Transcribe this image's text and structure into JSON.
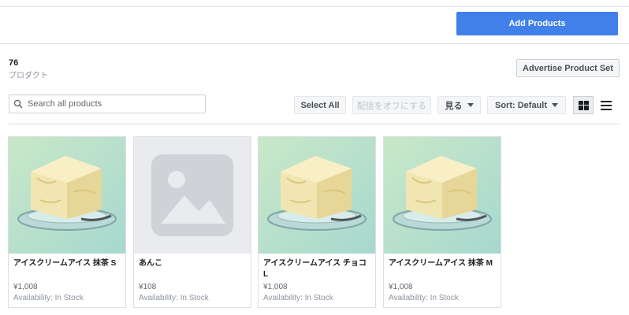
{
  "header": {
    "add_products_label": "Add Products"
  },
  "summary": {
    "count": "76",
    "count_label": "プロダクト"
  },
  "advertise_label": "Advertise Product Set",
  "search": {
    "placeholder": "Search all products",
    "value": ""
  },
  "toolbar": {
    "select_all": "Select All",
    "turn_off_delivery": "配信をオフにする",
    "view": "見る",
    "sort": "Sort: Default"
  },
  "products": [
    {
      "name": "アイスクリームアイス 抹茶 S",
      "price": "¥1,008",
      "availability": "Availability: In Stock",
      "image": "ice-cream"
    },
    {
      "name": "あんこ",
      "price": "¥108",
      "availability": "Availability: In Stock",
      "image": "placeholder"
    },
    {
      "name": "アイスクリームアイス チョコ L",
      "price": "¥1,008",
      "availability": "Availability: In Stock",
      "image": "ice-cream"
    },
    {
      "name": "アイスクリームアイス 抹茶 M",
      "price": "¥1,008",
      "availability": "Availability: In Stock",
      "image": "ice-cream"
    }
  ],
  "colors": {
    "primary": "#4080e8",
    "border": "#dddfe2",
    "muted": "#8d949e"
  }
}
